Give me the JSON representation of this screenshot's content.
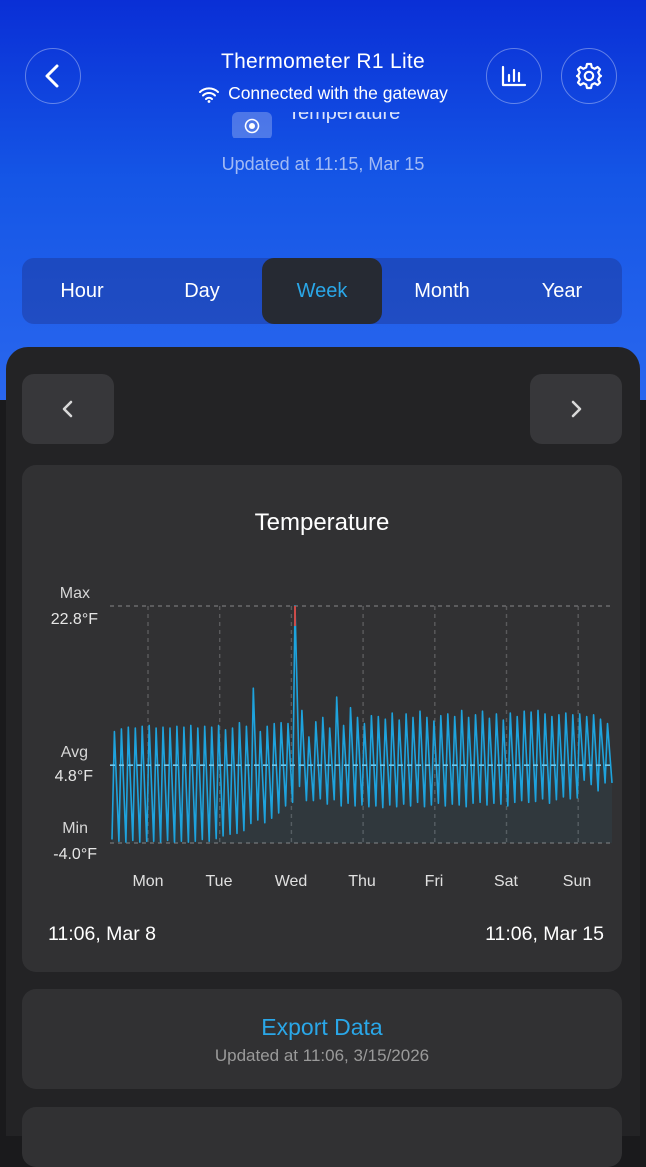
{
  "header": {
    "title": "Thermometer R1 Lite",
    "connection": "Connected with the gateway",
    "sensor_label": "Temperature",
    "updated": "Updated at 11:15,  Mar 15"
  },
  "tabs": [
    {
      "label": "Hour",
      "active": false
    },
    {
      "label": "Day",
      "active": false
    },
    {
      "label": "Week",
      "active": true
    },
    {
      "label": "Month",
      "active": false
    },
    {
      "label": "Year",
      "active": false
    }
  ],
  "chart_card": {
    "title": "Temperature",
    "max_label": "Max",
    "max_value": "22.8°F",
    "avg_label": "Avg",
    "avg_value": "4.8°F",
    "min_label": "Min",
    "min_value": "-4.0°F",
    "range_start": "11:06,  Mar 8",
    "range_end": "11:06,  Mar 15"
  },
  "chart_data": {
    "type": "line",
    "title": "Temperature",
    "categories": [
      "Mon",
      "Tue",
      "Wed",
      "Thu",
      "Fri",
      "Sat",
      "Sun"
    ],
    "ylim": [
      -4.0,
      22.8
    ],
    "reference_lines": {
      "max": 22.8,
      "avg": 4.8,
      "min": -4.0
    },
    "grid": true,
    "series": [
      {
        "color": "#1ea3dd",
        "cycles": [
          [
            -3.6,
            8.6
          ],
          [
            -3.8,
            8.9
          ],
          [
            -3.9,
            9.1
          ],
          [
            -3.7,
            9.0
          ],
          [
            -3.9,
            9.2
          ],
          [
            -3.8,
            9.3
          ],
          [
            -3.8,
            9.0
          ],
          [
            -3.9,
            9.1
          ],
          [
            -3.7,
            9.0
          ],
          [
            -3.9,
            9.2
          ],
          [
            -3.8,
            9.1
          ],
          [
            -3.9,
            9.3
          ],
          [
            -3.8,
            9.0
          ],
          [
            -3.6,
            9.2
          ],
          [
            -3.8,
            9.1
          ],
          [
            -3.5,
            9.3
          ],
          [
            -3.2,
            8.8
          ],
          [
            -3.0,
            9.0
          ],
          [
            -2.9,
            9.6
          ],
          [
            -2.6,
            9.2
          ],
          [
            -1.8,
            13.5
          ],
          [
            -1.4,
            8.6
          ],
          [
            -1.7,
            9.2
          ],
          [
            -1.2,
            9.5
          ],
          [
            -0.6,
            9.6
          ],
          [
            0.2,
            9.5
          ],
          [
            0.6,
            22.8
          ],
          [
            2.4,
            11.0
          ],
          [
            0.8,
            8.0
          ],
          [
            0.8,
            9.7
          ],
          [
            1.0,
            10.2
          ],
          [
            0.4,
            9.0
          ],
          [
            0.9,
            12.5
          ],
          [
            0.2,
            9.3
          ],
          [
            0.5,
            11.3
          ],
          [
            0.2,
            10.2
          ],
          [
            0.3,
            9.5
          ],
          [
            0.1,
            10.4
          ],
          [
            0.2,
            10.3
          ],
          [
            0.0,
            10.0
          ],
          [
            0.3,
            10.7
          ],
          [
            0.1,
            9.9
          ],
          [
            0.4,
            10.6
          ],
          [
            0.2,
            10.2
          ],
          [
            0.6,
            10.9
          ],
          [
            0.1,
            10.2
          ],
          [
            0.3,
            9.8
          ],
          [
            0.5,
            10.4
          ],
          [
            0.2,
            10.6
          ],
          [
            0.4,
            10.3
          ],
          [
            0.3,
            11.0
          ],
          [
            0.1,
            10.2
          ],
          [
            0.5,
            10.5
          ],
          [
            0.6,
            10.9
          ],
          [
            0.3,
            10.1
          ],
          [
            0.5,
            10.6
          ],
          [
            0.4,
            9.9
          ],
          [
            0.2,
            10.7
          ],
          [
            0.6,
            10.3
          ],
          [
            0.8,
            10.9
          ],
          [
            0.6,
            10.8
          ],
          [
            0.7,
            11.0
          ],
          [
            1.0,
            10.6
          ],
          [
            0.5,
            10.3
          ],
          [
            0.9,
            10.5
          ],
          [
            1.2,
            10.7
          ],
          [
            1.0,
            10.5
          ],
          [
            1.1,
            10.6
          ],
          [
            3.1,
            10.3
          ],
          [
            2.6,
            10.5
          ],
          [
            1.9,
            10.0
          ],
          [
            2.8,
            9.5
          ]
        ]
      }
    ]
  },
  "export": {
    "label": "Export Data",
    "updated": "Updated at 11:06,  3/15/2026"
  }
}
